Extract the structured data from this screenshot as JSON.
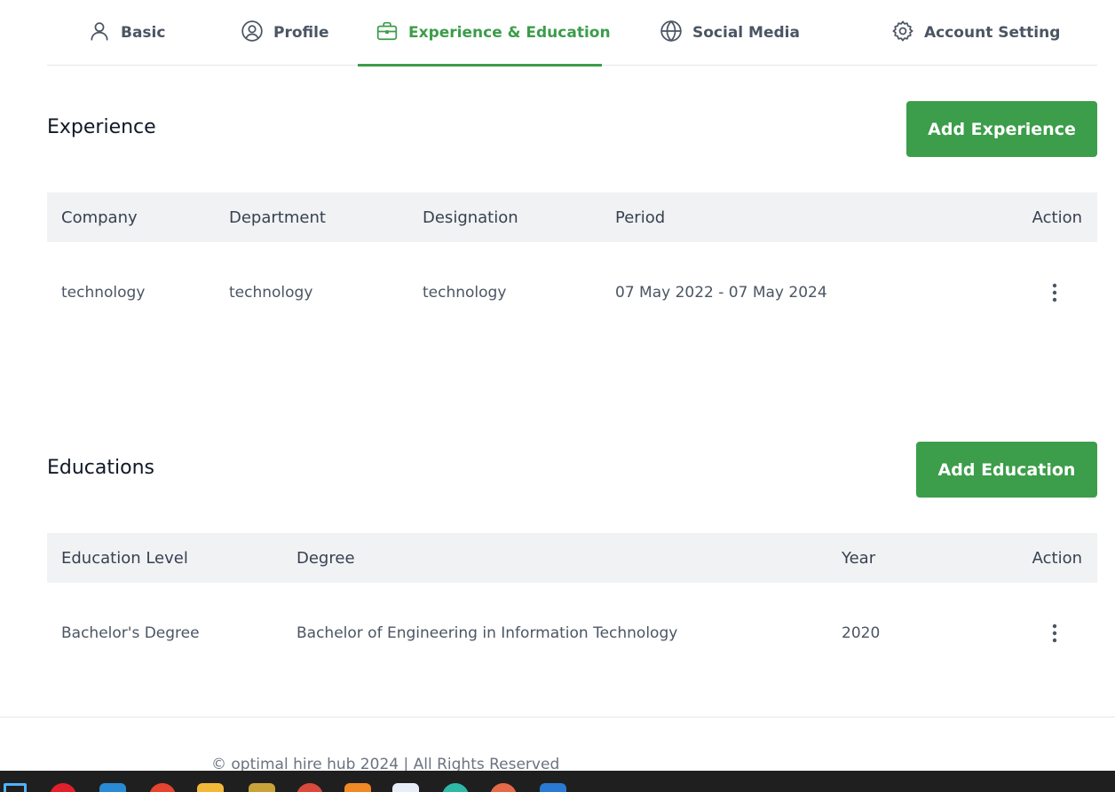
{
  "tabs": [
    {
      "label": "Basic",
      "icon": "user-icon",
      "active": false
    },
    {
      "label": "Profile",
      "icon": "user-circle-icon",
      "active": false
    },
    {
      "label": "Experience & Education",
      "icon": "briefcase-icon",
      "active": true
    },
    {
      "label": "Social Media",
      "icon": "globe-icon",
      "active": false
    },
    {
      "label": "Account Setting",
      "icon": "gear-icon",
      "active": false
    }
  ],
  "experience": {
    "title": "Experience",
    "add_button": "Add Experience",
    "columns": [
      "Company",
      "Department",
      "Designation",
      "Period",
      "Action"
    ],
    "rows": [
      {
        "company": "technology",
        "department": "technology",
        "designation": "technology",
        "period": "07 May 2022 - 07 May 2024"
      }
    ]
  },
  "education": {
    "title": "Educations",
    "add_button": "Add Education",
    "columns": [
      "Education Level",
      "Degree",
      "Year",
      "Action"
    ],
    "rows": [
      {
        "level": "Bachelor's Degree",
        "degree": "Bachelor of Engineering in Information Technology",
        "year": "2020"
      }
    ]
  },
  "footer": {
    "text": "© optimal hire hub 2024 | All Rights Reserved"
  },
  "colors": {
    "accent": "#3c9d4a",
    "header_bg": "#f1f2f4",
    "taskbar": "#1f1f1f"
  },
  "taskbar": {
    "icons": [
      {
        "name": "windows-start-icon",
        "color": "#4fb3ff"
      },
      {
        "name": "opera-icon",
        "color": "#e0202b"
      },
      {
        "name": "vscode-icon",
        "color": "#2a8ad4"
      },
      {
        "name": "chrome-icon",
        "color": "#e5442f"
      },
      {
        "name": "file-explorer-icon",
        "color": "#f2b938"
      },
      {
        "name": "app-icon",
        "color": "#c9a33a"
      },
      {
        "name": "app-icon",
        "color": "#d84a3c"
      },
      {
        "name": "sublime-icon",
        "color": "#f08a24"
      },
      {
        "name": "calendar-icon",
        "color": "#e8eef8"
      },
      {
        "name": "edge-icon",
        "color": "#2fb8a8"
      },
      {
        "name": "app-icon",
        "color": "#e46a4a"
      },
      {
        "name": "app-icon",
        "color": "#2a7ad4"
      }
    ]
  }
}
